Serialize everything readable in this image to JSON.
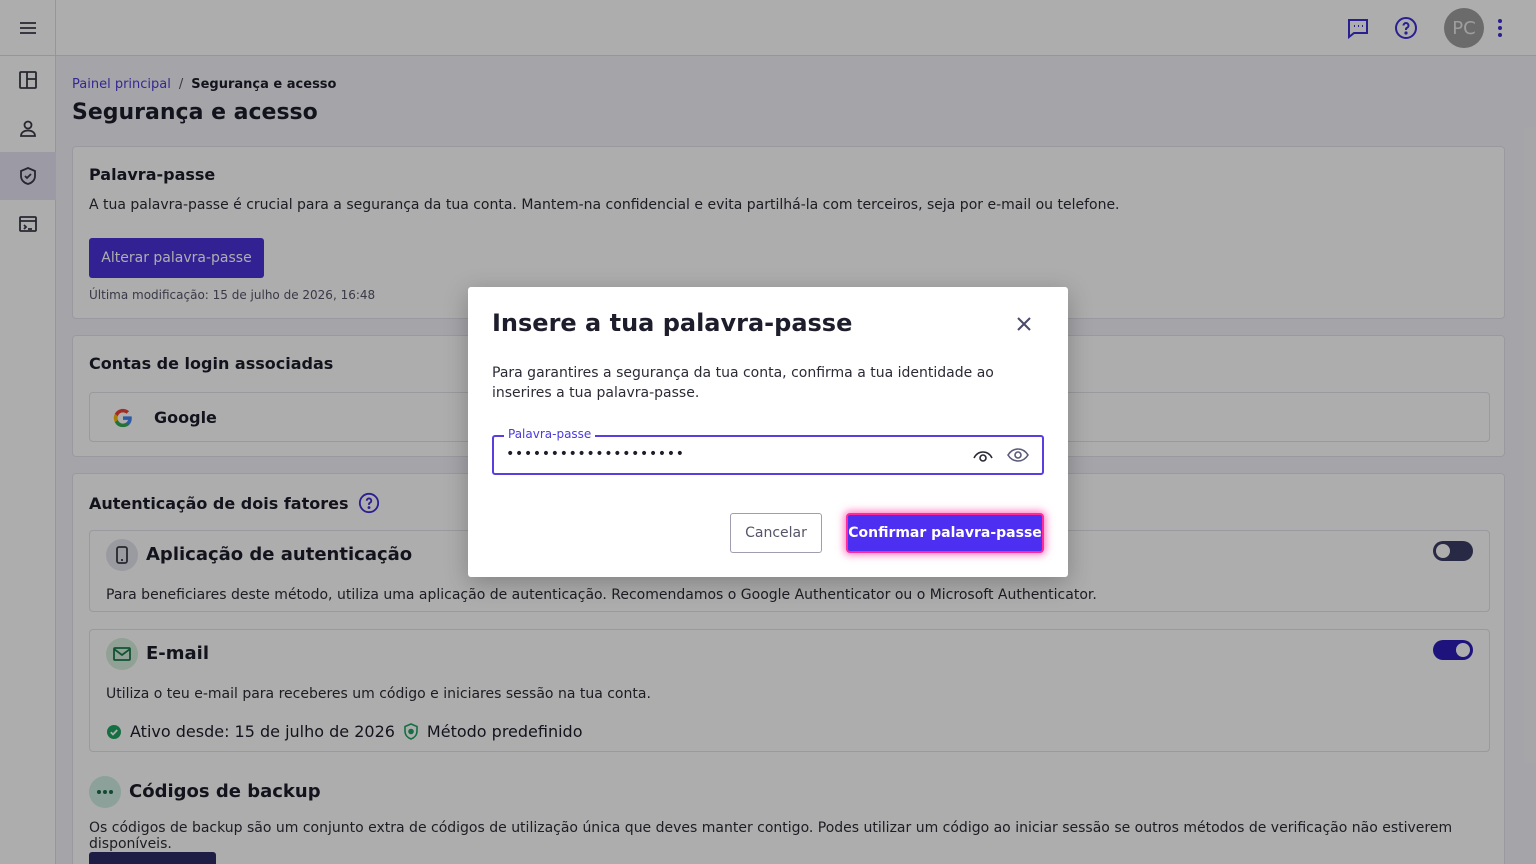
{
  "topbar": {
    "avatar_initials": "PC"
  },
  "breadcrumb": {
    "home": "Painel principal",
    "separator": "/",
    "current": "Segurança e acesso"
  },
  "page": {
    "title": "Segurança e acesso"
  },
  "password_card": {
    "title": "Palavra-passe",
    "description": "A tua palavra-passe é crucial para a segurança da tua conta. Mantem-na confidencial e evita partilhá-la com terceiros, seja por e-mail ou telefone.",
    "change_button": "Alterar palavra-passe",
    "last_modified": "Última modificação: 15 de julho de 2026, 16:48"
  },
  "login_card": {
    "title": "Contas de login associadas",
    "accounts": [
      {
        "name": "Google"
      }
    ]
  },
  "two_factor": {
    "title": "Autenticação de dois fatores",
    "methods": {
      "app": {
        "title": "Aplicação de autenticação",
        "description": "Para beneficiares deste método, utiliza uma aplicação de autenticação. Recomendamos o Google Authenticator ou o Microsoft Authenticator.",
        "enabled": false
      },
      "email": {
        "title": "E-mail",
        "description": "Utiliza o teu e-mail para receberes um código e iniciares sessão na tua conta.",
        "active_since": "Ativo desde: 15 de julho de 2026",
        "default_label": "Método predefinido",
        "enabled": true
      },
      "backup": {
        "title": "Códigos de backup",
        "description": "Os códigos de backup são um conjunto extra de códigos de utilização única que deves manter contigo. Podes utilizar um código ao iniciar sessão se outros métodos de verificação não estiverem disponíveis."
      }
    }
  },
  "modal": {
    "title": "Insere a tua palavra-passe",
    "description": "Para garantires a segurança da tua conta, confirma a tua identidade ao inserires a tua palavra-passe.",
    "field_label": "Palavra-passe",
    "field_value": "••••••••••••••••••••",
    "cancel_label": "Cancelar",
    "confirm_label": "Confirmar palavra-passe"
  },
  "colors": {
    "accent": "#4a32d8",
    "confirm_highlight": "#ff2a9d",
    "success": "#1fa463"
  },
  "icons": [
    "menu-icon",
    "dashboard-icon",
    "user-icon",
    "shield-icon",
    "terminal-icon",
    "chat-icon",
    "help-icon",
    "kebab-icon",
    "close-icon",
    "eye-icon",
    "google-icon",
    "phone-icon",
    "mail-icon",
    "dots-icon",
    "check-circle-icon"
  ]
}
